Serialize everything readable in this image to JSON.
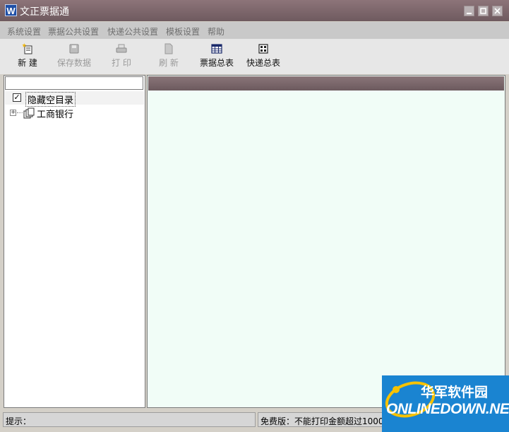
{
  "window": {
    "title": "文正票据通",
    "app_icon_letter": "W"
  },
  "menu": [
    {
      "label": "系统设置"
    },
    {
      "label": "票据公共设置"
    },
    {
      "label": "快递公共设置"
    },
    {
      "label": "模板设置"
    },
    {
      "label": "帮助"
    }
  ],
  "toolbar": {
    "new": "新 建",
    "save": "保存数据",
    "print": "打 印",
    "refresh": "刷 新",
    "ticket_summary": "票据总表",
    "express_summary": "快递总表"
  },
  "left_panel": {
    "search_value": "",
    "hide_empty_label": "隐藏空目录",
    "hide_empty_checked": "✓",
    "tree_items": [
      {
        "label": "工商银行",
        "expander": "+"
      }
    ]
  },
  "status": {
    "hint": "提示：",
    "message": "免费版：不能打印金额超过1000"
  },
  "watermark": {
    "cn": "华军软件园",
    "en": "ONLINEDOWN.NET"
  },
  "colors": {
    "titlebar": "#7a6468",
    "content_bg": "#f1fdf7",
    "watermark_bg": "#1a84d1"
  }
}
